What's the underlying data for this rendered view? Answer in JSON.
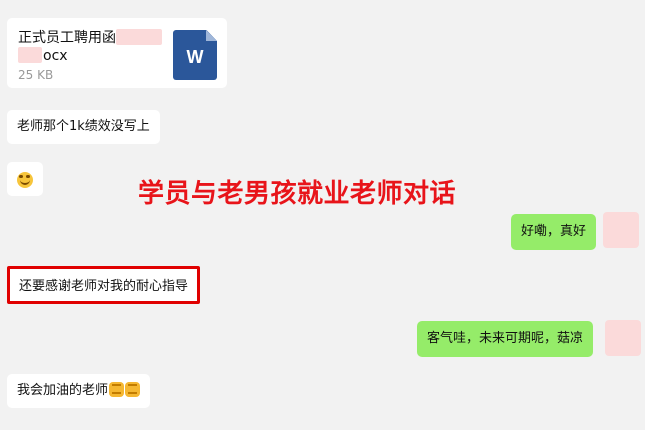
{
  "file_message": {
    "name_prefix": "正式员工聘用函",
    "extension": "ocx",
    "size": "25 KB",
    "icon_letter": "W",
    "icon": "word-document-icon"
  },
  "messages": [
    {
      "text": "老师那个1k绩效没写上"
    },
    {
      "emoji": "tears-of-joy-emoji-icon"
    },
    {
      "text": "好嘞，真好"
    },
    {
      "text": "还要感谢老师对我的耐心指导"
    },
    {
      "text": "客气哇，未来可期呢，菇凉"
    },
    {
      "text": "我会加油的老师",
      "emojis": [
        "fist-emoji-icon",
        "fist-emoji-icon"
      ]
    }
  ],
  "overlay_title": "学员与老男孩就业老师对话",
  "colors": {
    "background": "#f2f2f2",
    "incoming_bubble": "#ffffff",
    "outgoing_bubble": "#95ec69",
    "title": "#e8141a",
    "highlight_border": "#e00000",
    "privacy_mask": "#fbdada"
  }
}
